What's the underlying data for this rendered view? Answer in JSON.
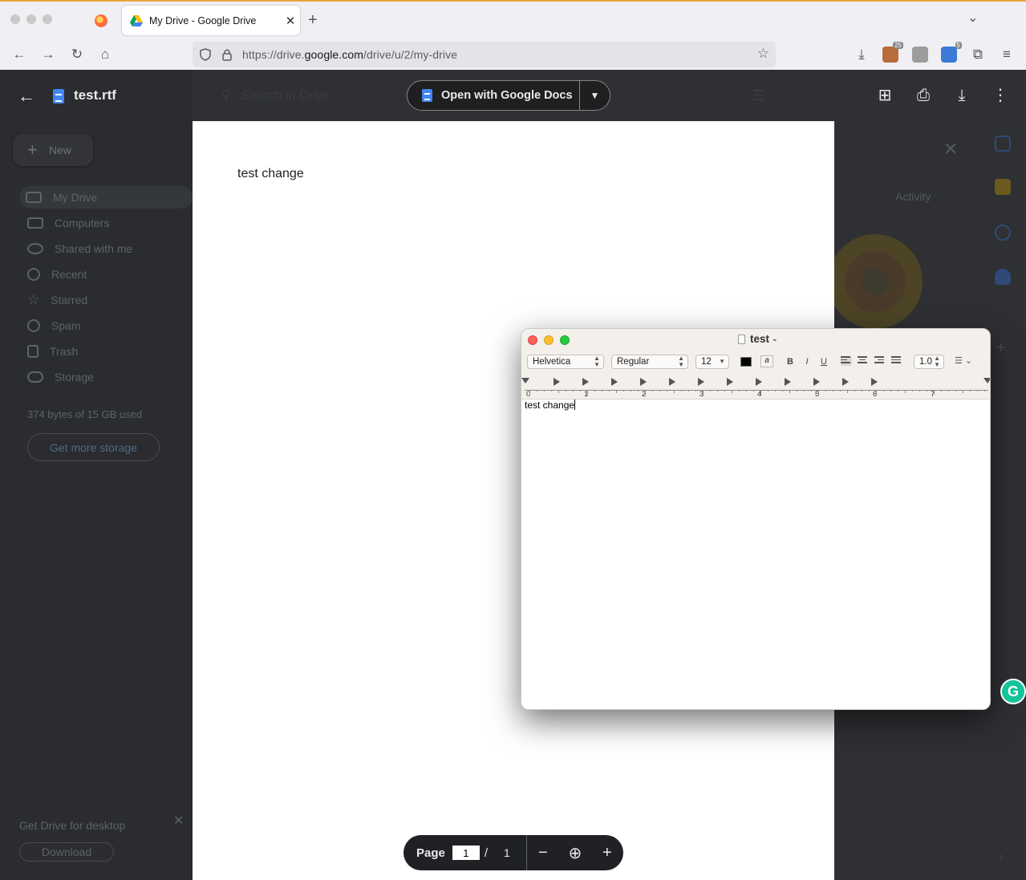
{
  "browser": {
    "tab_title": "My Drive - Google Drive",
    "url_prefix": "https://drive.",
    "url_domain": "google.com",
    "url_path": "/drive/u/2/my-drive",
    "ext_badge_1": "25",
    "ext_badge_2": "5"
  },
  "drive": {
    "new_label": "New",
    "sidebar": [
      "My Drive",
      "Computers",
      "Shared with me",
      "Recent",
      "Starred",
      "Spam",
      "Trash",
      "Storage"
    ],
    "storage_used": "374 bytes of 15 GB used",
    "get_more_storage": "Get more storage",
    "desktop_promo": "Get Drive for desktop",
    "download_label": "Download",
    "search_placeholder": "Search in Drive",
    "activity_tab": "Activity"
  },
  "viewer": {
    "file_name": "test.rtf",
    "open_with_label": "Open with Google Docs",
    "doc_text": "test change",
    "page_label": "Page",
    "page_current": "1",
    "page_separator": "/",
    "page_total": "1"
  },
  "textedit": {
    "title": "test",
    "font_family": "Helvetica",
    "font_style": "Regular",
    "font_size": "12",
    "line_spacing": "1.0",
    "bold": "B",
    "italic": "I",
    "underline": "U",
    "ruler_numbers": [
      "0",
      "1",
      "2",
      "3",
      "4",
      "5",
      "6",
      "7"
    ],
    "body_text": "test change"
  },
  "grammarly_letter": "G"
}
